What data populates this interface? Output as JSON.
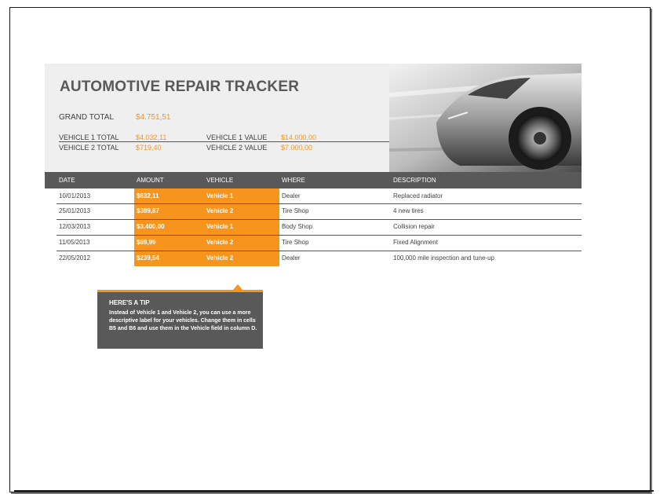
{
  "header": {
    "title": "AUTOMOTIVE REPAIR TRACKER",
    "grand_total_label": "GRAND TOTAL",
    "grand_total_value": "$4.751,51",
    "vehicle1_total_label": "VEHICLE 1 TOTAL",
    "vehicle1_total_value": "$4.032,11",
    "vehicle2_total_label": "VEHICLE 2 TOTAL",
    "vehicle2_total_value": "$719,40",
    "vehicle1_value_label": "VEHICLE 1  VALUE",
    "vehicle1_value": "$14.000,00",
    "vehicle2_value_label": "VEHICLE 2  VALUE",
    "vehicle2_value": "$7.000,00"
  },
  "table": {
    "columns": [
      "DATE",
      "AMOUNT",
      "VEHICLE",
      "WHERE",
      "DESCRIPTION"
    ],
    "rows": [
      {
        "date": "10/01/2013",
        "amount": "$632,11",
        "vehicle": "Vehicle 1",
        "where": "Dealer",
        "description": "Replaced radiator"
      },
      {
        "date": "25/01/2013",
        "amount": "$389,87",
        "vehicle": "Vehicle 2",
        "where": "Tire Shop",
        "description": "4 new tires"
      },
      {
        "date": "12/03/2013",
        "amount": "$3.400,00",
        "vehicle": "Vehicle 1",
        "where": "Body Shop",
        "description": "Collision repair"
      },
      {
        "date": "11/05/2013",
        "amount": "$89,99",
        "vehicle": "Vehicle 2",
        "where": "Tire Shop",
        "description": "Fixed Alignment"
      },
      {
        "date": "22/05/2012",
        "amount": "$239,54",
        "vehicle": "Vehicle 2",
        "where": "Dealer",
        "description": "100,000 mile inspection and tune-up"
      }
    ]
  },
  "tip": {
    "title": "HERE'S A TIP",
    "text": "Instead of Vehicle 1 and Vehicle 2, you can use a more descriptive label for your vehicles. Change them in cells B5 and B6 and use them in the Vehicle field in column D."
  },
  "colors": {
    "accent": "#f7941d",
    "header_bg": "#595959",
    "panel_bg": "#efefef"
  },
  "icons": {
    "hero_image": "car-photo"
  }
}
